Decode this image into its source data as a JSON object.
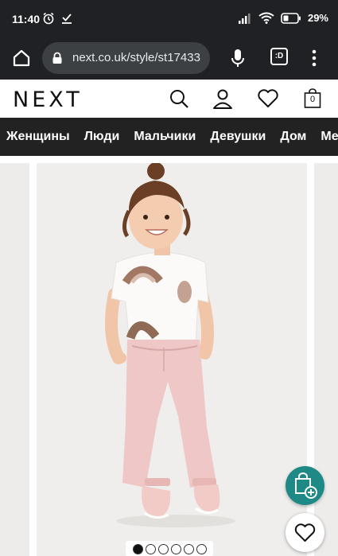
{
  "status_bar": {
    "time": "11:40",
    "battery": "29%",
    "icons": [
      "alarm-icon",
      "download-done-icon",
      "signal-icon",
      "wifi-icon",
      "battery-icon"
    ]
  },
  "browser": {
    "url": "next.co.uk/style/st17433",
    "tabs_label": ":D"
  },
  "site": {
    "logo": "NEXT",
    "bag_count": "0"
  },
  "nav": {
    "items": [
      "Женщины",
      "Люди",
      "Мальчики",
      "Девушки",
      "Дом",
      "Ме"
    ]
  },
  "gallery": {
    "image_count": 6,
    "active_index": 0
  },
  "colors": {
    "status_bg": "#202124",
    "nav_bg": "#222222",
    "accent_teal": "#1f8a85",
    "photo_bg": "#efeeec"
  }
}
